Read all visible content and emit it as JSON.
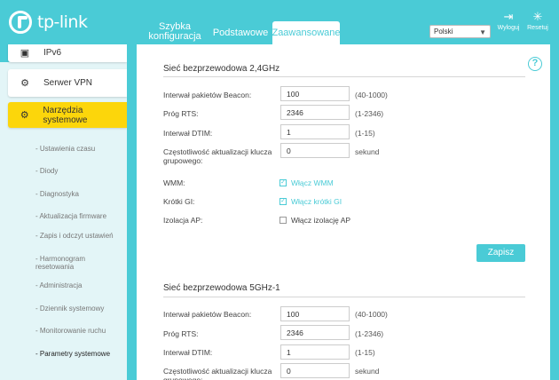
{
  "header": {
    "logo_text": "tp-link",
    "tabs": [
      {
        "label_line1": "Szybka",
        "label_line2": "konfiguracja"
      },
      {
        "label": "Podstawowe"
      },
      {
        "label": "Zaawansowane"
      }
    ],
    "language": "Polski",
    "logout_label": "Wyloguj",
    "reset_label": "Resetuj"
  },
  "sidebar": {
    "items": [
      {
        "label": "IPv6",
        "icon": "ipv6-icon"
      },
      {
        "label": "Serwer VPN",
        "icon": "vpn-icon"
      },
      {
        "label": "Narzędzia systemowe",
        "icon": "gear-icon"
      }
    ],
    "submenu": [
      {
        "label": "Ustawienia czasu"
      },
      {
        "label": "Diody"
      },
      {
        "label": "Diagnostyka"
      },
      {
        "label": "Aktualizacja firmware"
      },
      {
        "label": "Zapis i odczyt ustawień"
      },
      {
        "label": "Harmonogram resetowania"
      },
      {
        "label": "Administracja"
      },
      {
        "label": "Dziennik systemowy"
      },
      {
        "label": "Monitorowanie ruchu"
      },
      {
        "label": "Parametry systemowe"
      }
    ]
  },
  "section1": {
    "title": "Sieć bezprzewodowa 2,4GHz",
    "beacon_label": "Interwał pakietów Beacon:",
    "beacon_value": "100",
    "beacon_hint": "(40-1000)",
    "rts_label": "Próg RTS:",
    "rts_value": "2346",
    "rts_hint": "(1-2346)",
    "dtim_label": "Interwał DTIM:",
    "dtim_value": "1",
    "dtim_hint": "(1-15)",
    "gkey_label": "Częstotliwość aktualizacji klucza grupowego:",
    "gkey_value": "0",
    "gkey_hint": "sekund",
    "wmm_label": "WMM:",
    "wmm_check": "Włącz WMM",
    "sgi_label": "Krótki GI:",
    "sgi_check": "Włącz krótki GI",
    "ap_label": "Izolacja AP:",
    "ap_check": "Włącz izolację AP",
    "save_label": "Zapisz"
  },
  "section2": {
    "title": "Sieć bezprzewodowa 5GHz-1",
    "beacon_label": "Interwał pakietów Beacon:",
    "beacon_value": "100",
    "beacon_hint": "(40-1000)",
    "rts_label": "Próg RTS:",
    "rts_value": "2346",
    "rts_hint": "(1-2346)",
    "dtim_label": "Interwał DTIM:",
    "dtim_value": "1",
    "dtim_hint": "(1-15)",
    "gkey_label": "Częstotliwość aktualizacji klucza grupowego:",
    "gkey_value": "0",
    "gkey_hint": "sekund"
  },
  "colors": {
    "accent": "#4acbd6",
    "active_menu": "#fcd60b"
  }
}
